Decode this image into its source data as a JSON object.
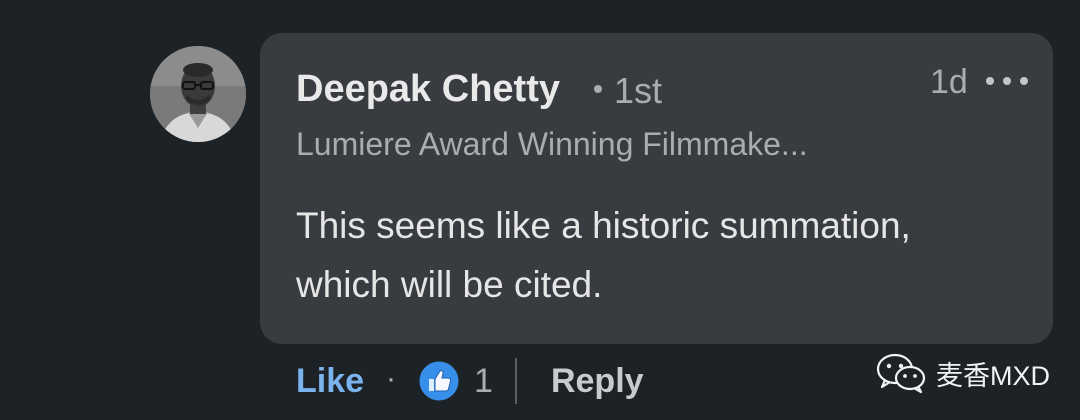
{
  "comment": {
    "author_name": "Deepak Chetty",
    "connection_degree": "1st",
    "timestamp": "1d",
    "headline": "Lumiere Award Winning Filmmake...",
    "text": "This seems like a historic summation, which will be cited.",
    "more_icon": "more-horizontal-icon"
  },
  "actions": {
    "like_label": "Like",
    "separator": "·",
    "reaction_icon": "thumbs-up-icon",
    "reaction_count": "1",
    "reply_label": "Reply"
  },
  "watermark": {
    "icon": "wechat-icon",
    "text": "麦香MXD"
  },
  "colors": {
    "background": "#1d2226",
    "bubble": "#383c40",
    "like_accent": "#7ab3ee",
    "reaction_blue": "#378fe9"
  }
}
